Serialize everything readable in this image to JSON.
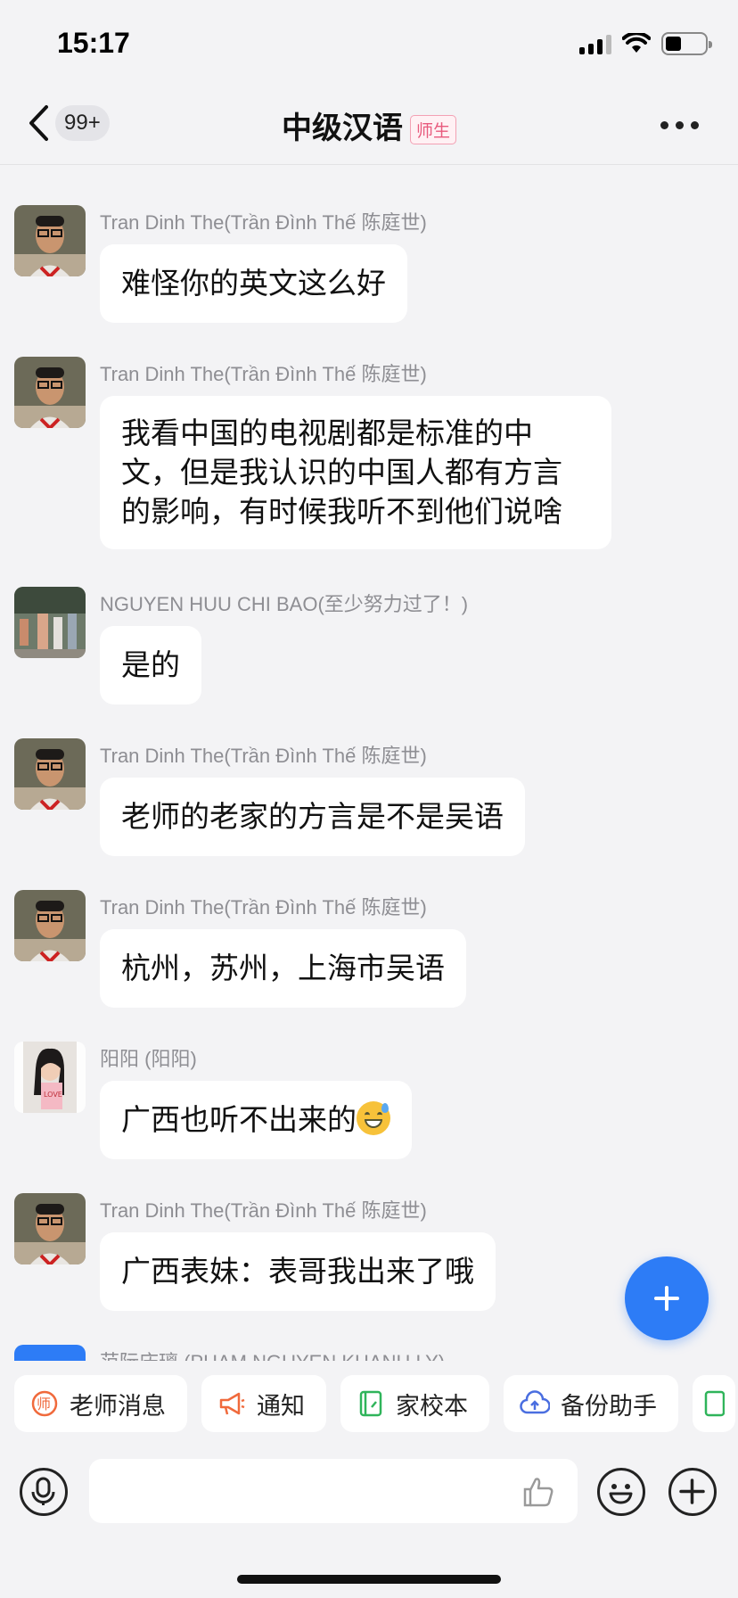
{
  "status_bar": {
    "time": "15:17"
  },
  "nav": {
    "back_badge": "99+",
    "title": "中级汉语",
    "title_tag": "师生"
  },
  "messages": [
    {
      "sender": "Tran Dinh The(Trần Đình Thế 陈庭世)",
      "text": "难怪你的英文这么好",
      "avatar": "portrait-man-glasses"
    },
    {
      "sender": "Tran Dinh The(Trần Đình Thế 陈庭世)",
      "text": "我看中国的电视剧都是标准的中文，但是我认识的中国人都有方言的影响，有时候我听不到他们说啥",
      "avatar": "portrait-man-glasses"
    },
    {
      "sender": "NGUYEN HUU CHI BAO(至少努力过了！)",
      "text": "是的",
      "avatar": "street-photo"
    },
    {
      "sender": "Tran Dinh The(Trần Đình Thế 陈庭世)",
      "text": "老师的老家的方言是不是吴语",
      "avatar": "portrait-man-glasses"
    },
    {
      "sender": "Tran Dinh The(Trần Đình Thế 陈庭世)",
      "text": "杭州，苏州，上海市吴语",
      "avatar": "portrait-man-glasses"
    },
    {
      "sender": "阳阳 (阳阳)",
      "text": "广西也听不出来的",
      "emoji": "sweat-smile-emoji",
      "avatar": "portrait-woman"
    },
    {
      "sender": "Tran Dinh The(Trần Đình Thế 陈庭世)",
      "text": "广西表妹：表哥我出来了哦",
      "avatar": "portrait-man-glasses"
    },
    {
      "sender": "范阮庆璃 (PHAM NGUYEN KHANH LY)",
      "text": "",
      "avatar": "blue-avatar"
    }
  ],
  "quick_actions": [
    {
      "label": "老师消息",
      "icon": "teacher-icon",
      "color": "#f06a3c"
    },
    {
      "label": "通知",
      "icon": "megaphone-icon",
      "color": "#f06a3c"
    },
    {
      "label": "家校本",
      "icon": "notebook-icon",
      "color": "#2fb45a"
    },
    {
      "label": "备份助手",
      "icon": "cloud-backup-icon",
      "color": "#4a6ee0"
    }
  ],
  "input": {
    "placeholder": ""
  },
  "colors": {
    "accent": "#2d7cf6",
    "tag_pink": "#e85a7d"
  }
}
